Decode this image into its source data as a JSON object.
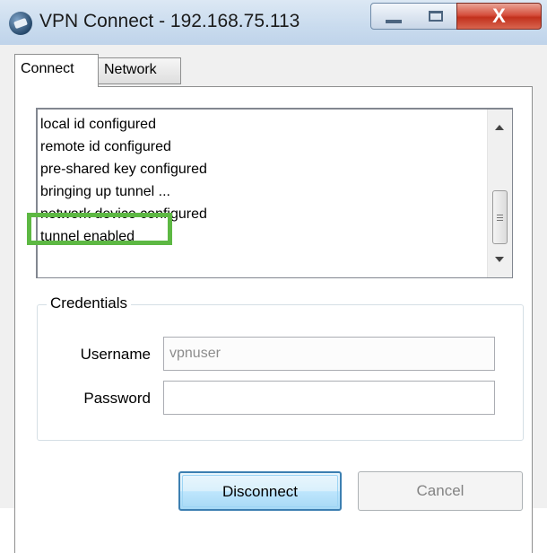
{
  "window": {
    "title": "VPN Connect - 192.168.75.113",
    "controls": {
      "minimize": "minimize-icon",
      "maximize": "maximize-icon",
      "close": "close-icon"
    }
  },
  "tabs": [
    {
      "label": "Connect",
      "active": true
    },
    {
      "label": "Network",
      "active": false
    }
  ],
  "log": {
    "lines": [
      "local id configured",
      "remote id configured",
      "pre-shared key configured",
      "bringing up tunnel ...",
      "network device configured",
      "tunnel enabled"
    ],
    "highlight_color": "#5db843"
  },
  "credentials": {
    "legend": "Credentials",
    "username_label": "Username",
    "username_value": "vpnuser",
    "password_label": "Password",
    "password_value": ""
  },
  "buttons": {
    "disconnect": "Disconnect",
    "cancel": "Cancel"
  },
  "colors": {
    "accent": "#3c7fb1",
    "close_button": "#c2311d"
  }
}
